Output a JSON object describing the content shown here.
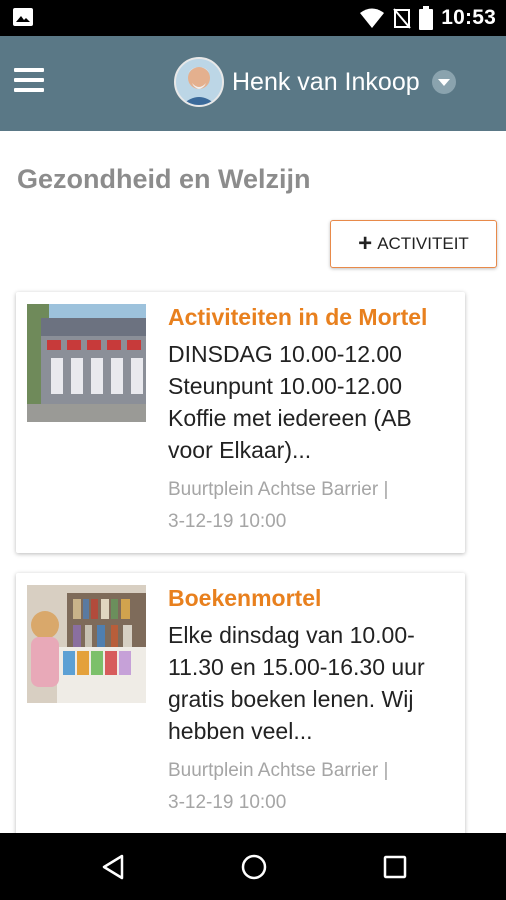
{
  "status_bar": {
    "time": "10:53",
    "icons": [
      "image-icon",
      "wifi-icon",
      "no-signal-icon",
      "battery-icon"
    ]
  },
  "app_bar": {
    "user_name": "Henk van Inkoop",
    "background": "#5a7886"
  },
  "page": {
    "title": "Gezondheid en Welzijn",
    "add_button": "ACTIVITEIT"
  },
  "cards": [
    {
      "title": "Activiteiten in de Mortel",
      "description": "DINSDAG 10.00-12.00 Steunpunt 10.00-12.00 Koffie met iedereen (AB voor Elkaar)...",
      "location": "Buurtplein Achtse Barrier |",
      "date": "3-12-19 10:00"
    },
    {
      "title": "Boekenmortel",
      "description": "Elke dinsdag van 10.00-11.30 en 15.00-16.30 uur gratis boeken lenen. Wij hebben veel...",
      "location": "Buurtplein Achtse Barrier |",
      "date": "3-12-19 10:00"
    }
  ],
  "colors": {
    "accent": "#e8801e",
    "title_gray": "#8c8c8c",
    "meta_gray": "#a5a5a5"
  }
}
